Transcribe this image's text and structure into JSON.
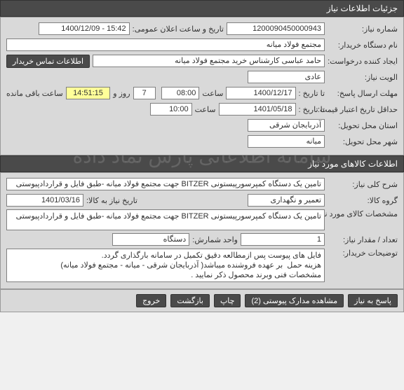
{
  "sections": {
    "need_info_header": "جزئیات اطلاعات نیاز",
    "goods_info_header": "اطلاعات کالاهای مورد نیاز"
  },
  "watermark": "سامانه اطلاعاتی پارس نماد داده",
  "need": {
    "labels": {
      "need_no": "شماره نیاز:",
      "ann_datetime": "تاریخ و ساعت اعلان عمومی:",
      "buyer_name": "نام دستگاه خریدار:",
      "requester": "ایجاد کننده درخواست:",
      "contact_btn": "اطلاعات تماس خریدار",
      "priority": "الویت نیاز:",
      "reply_deadline": "مهلت ارسال پاسخ:",
      "price_validity": "حداقل تاریخ اعتبار قیمت:",
      "delivery_province": "استان محل تحویل:",
      "delivery_city": "شهر محل تحویل:",
      "to_date": "تا تاریخ :",
      "to_date2": "تا تاریخ :",
      "time": "ساعت",
      "days_and": "روز و",
      "time_remaining": "ساعت باقی مانده"
    },
    "need_no": "1200090450000943",
    "ann_datetime": "15:42 - 1400/12/09",
    "buyer_name": "مجتمع فولاد میانه",
    "requester": "حامد عباسی کارشناس خرید مجتمع فولاد میانه",
    "priority": "عادی",
    "reply_to_date": "1400/12/17",
    "reply_time": "08:00",
    "days_left": "7",
    "countdown": "14:51:15",
    "validity_to_date": "1401/05/18",
    "validity_time": "10:00",
    "province": "آذربایجان شرقی",
    "city": "میانه"
  },
  "goods": {
    "labels": {
      "summary": "شرح کلی نیاز:",
      "group": "گروه کالا:",
      "need_date": "تاریخ نیاز به کالا:",
      "spec": "مشخصات کالای مورد نیاز:",
      "qty": "تعداد / مقدار نیاز:",
      "unit": "واحد شمارش:",
      "buyer_notes": "توضیحات خریدار:"
    },
    "summary": "تامین یک دستگاه کمپرسورپیستونی BITZER جهت مجتمع فولاد میانه -طبق فایل و قراردادپیوستی",
    "group": "تعمیر و نگهداری",
    "need_date": "1401/03/16",
    "spec": "تامین یک دستگاه کمپرسورپیستونی BITZER جهت مجتمع فولاد میانه -طبق فایل و قراردادپیوستی",
    "qty": "1",
    "unit": "دستگاه",
    "buyer_notes": "فایل های پیوست پس ازمطالعه دقیق تکمیل در سامانه بارگذاری گردد.\nهزینه حمل  بر عهده فروشنده میباشد( آذربایجان شرقی - میانه - مجتمع فولاد میانه)\nمشخصات فنی وبرند محصول ذکر نمایید ."
  },
  "buttons": {
    "reply": "پاسخ به نیاز",
    "attachments": "مشاهده مدارک پیوستی (2)",
    "print": "چاپ",
    "back": "بازگشت",
    "exit": "خروج"
  }
}
